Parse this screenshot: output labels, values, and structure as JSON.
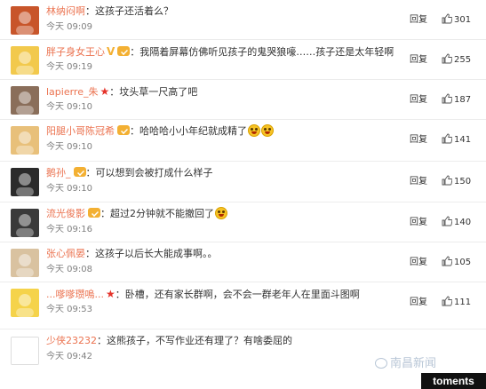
{
  "ui": {
    "reply_label": "回复",
    "watermark_text": "南昌新闻",
    "tag_text": "toments",
    "colors": {
      "username": "#eb7350",
      "time": "#808080",
      "vip": "#f3b033",
      "star": "#e5332a"
    }
  },
  "comments": [
    {
      "username": "林纳闷啊",
      "badges": [],
      "text": "这孩子还活着么？",
      "emoji_after": 0,
      "time": "今天 09:09",
      "likes": "301",
      "avatar_color": "#c8552a"
    },
    {
      "username": "胖子身女王心",
      "badges": [
        "v",
        "vip"
      ],
      "text": "我隔着屏幕仿佛听见孩子的鬼哭狼嚎……孩子还是太年轻啊",
      "emoji_after": 0,
      "time": "今天 09:19",
      "likes": "255",
      "avatar_color": "#f2c94c"
    },
    {
      "username": "lapierre_朱",
      "badges": [
        "star"
      ],
      "text": "坟头草一尺高了吧",
      "emoji_after": 0,
      "time": "今天 09:10",
      "likes": "187",
      "avatar_color": "#8a6e5a"
    },
    {
      "username": "阳腿小哥陈冠希",
      "badges": [
        "vip"
      ],
      "text": "哈哈哈小小年纪就成精了",
      "emoji_after": 2,
      "time": "今天 09:10",
      "likes": "141",
      "avatar_color": "#e8c07a"
    },
    {
      "username": "鹅孙_",
      "badges": [
        "vip"
      ],
      "text": "可以想到会被打成什么样子",
      "emoji_after": 0,
      "time": "今天 09:10",
      "likes": "150",
      "avatar_color": "#2b2b2b"
    },
    {
      "username": "流光俊影",
      "badges": [
        "vip"
      ],
      "text": "超过2分钟就不能撤回了",
      "emoji_after": 1,
      "time": "今天 09:16",
      "likes": "140",
      "avatar_color": "#3a3a3a"
    },
    {
      "username": "张心佩晏",
      "badges": [],
      "text": "这孩子以后长大能成事啊。。",
      "emoji_after": 0,
      "time": "今天 09:08",
      "likes": "105",
      "avatar_color": "#d9c2a0"
    },
    {
      "username": "...嗲嗲瓒嗚...",
      "badges": [
        "star"
      ],
      "text": "卧槽，还有家长群啊，会不会一群老年人在里面斗图啊",
      "emoji_after": 0,
      "time": "今天 09:53",
      "likes": "111",
      "avatar_color": "#f5d34a"
    },
    {
      "username": "少侠23232",
      "badges": [],
      "text": "这熊孩子，不写作业还有理了？有啥委屈的",
      "emoji_after": 0,
      "time": "今天 09:42",
      "likes": "",
      "avatar_color": "#ffffff"
    }
  ]
}
